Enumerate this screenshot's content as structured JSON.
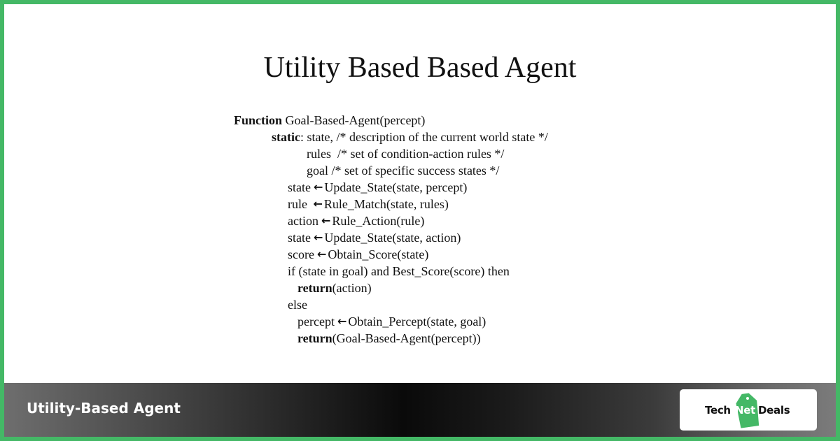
{
  "slide": {
    "title": "Utility Based Based Agent"
  },
  "code": {
    "lines": [
      {
        "kw": "Function",
        "text": " Goal-Based-Agent(percept)"
      },
      {
        "kw": "static",
        "text": ": state, /* description of the current world state */"
      },
      {
        "text": "rules  /* set of condition-action rules */"
      },
      {
        "text": "goal /* set of specific success states */"
      },
      {
        "lhs": "state",
        "arrow": "←",
        "rhs": "Update_State(state, percept)"
      },
      {
        "lhs": "rule ",
        "arrow": "←",
        "rhs": "Rule_Match(state, rules)"
      },
      {
        "lhs": "action",
        "arrow": "←",
        "rhs": "Rule_Action(rule)"
      },
      {
        "lhs": "state",
        "arrow": "←",
        "rhs": "Update_State(state, action)"
      },
      {
        "lhs": "score",
        "arrow": "←",
        "rhs": "Obtain_Score(state)"
      },
      {
        "text": "if (state in goal) and Best_Score(score) then"
      },
      {
        "kw": "return",
        "text": "(action)"
      },
      {
        "text": "else"
      },
      {
        "lhs": "percept",
        "arrow": "←",
        "rhs": "Obtain_Percept(state, goal)"
      },
      {
        "kw": "return",
        "text": "(Goal-Based-Agent(percept))"
      }
    ]
  },
  "banner": {
    "title": "Utility-Based Agent",
    "logo": {
      "part1": "Tech",
      "part2": "Net",
      "part3": "Deals",
      "tag_icon": "price-tag-icon"
    }
  },
  "colors": {
    "border": "#44b866",
    "logo_tag": "#44b866"
  }
}
